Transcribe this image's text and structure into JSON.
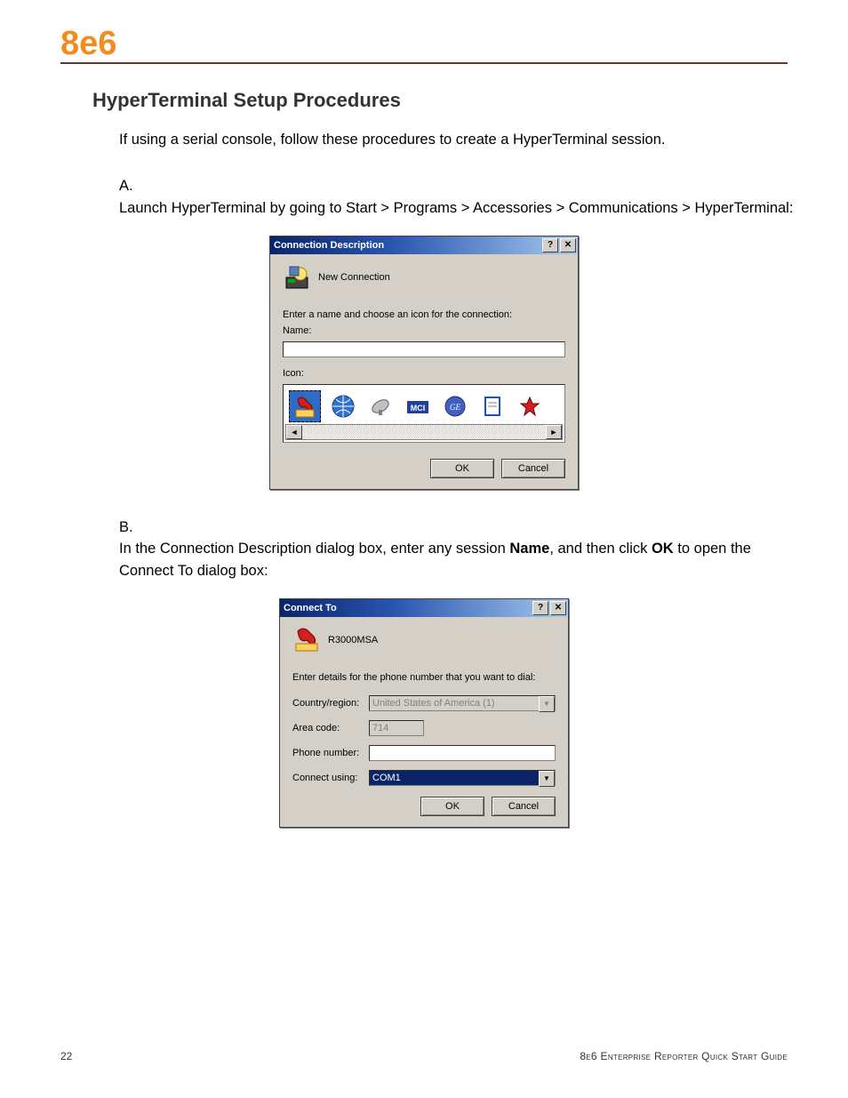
{
  "header": {
    "logo": "8e6"
  },
  "section": {
    "title": "HyperTerminal Setup Procedures",
    "intro": "If using a serial console, follow these procedures to create a HyperTerminal session."
  },
  "steps": {
    "a": {
      "label": "A.",
      "text": "Launch HyperTerminal by going to Start > Programs > Accessories > Communications > HyperTerminal:"
    },
    "b": {
      "label": "B.",
      "prefix": "In the Connection Description dialog box, enter any session ",
      "bold1": "Name",
      "mid": ", and then click ",
      "bold2": "OK",
      "suffix": " to open the Connect To dialog box:"
    }
  },
  "dialog1": {
    "title": "Connection Description",
    "header_label": "New Connection",
    "instruction": "Enter a name and choose an icon for the connection:",
    "name_label": "Name:",
    "name_value": "",
    "icon_label": "Icon:",
    "ok": "OK",
    "cancel": "Cancel"
  },
  "dialog2": {
    "title": "Connect To",
    "header_label": "R3000MSA",
    "instruction": "Enter details for the phone number that you want to dial:",
    "country_label": "Country/region:",
    "country_value": "United States of America (1)",
    "area_label": "Area code:",
    "area_value": "714",
    "phone_label": "Phone number:",
    "phone_value": "",
    "connect_label": "Connect using:",
    "connect_value": "COM1",
    "ok": "OK",
    "cancel": "Cancel"
  },
  "footer": {
    "page": "22",
    "doc": "8e6 Enterprise Reporter Quick Start Guide"
  }
}
